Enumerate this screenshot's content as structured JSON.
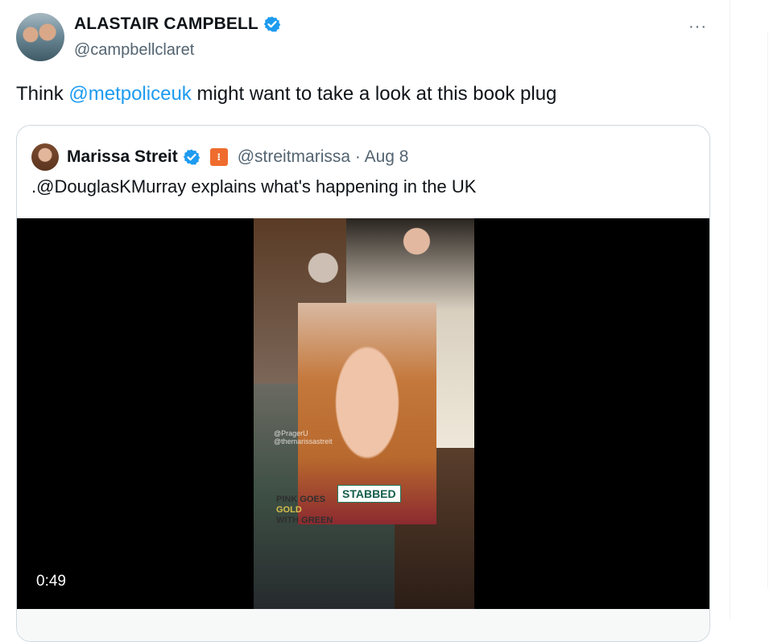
{
  "tweet": {
    "author_name": "ALASTAIR CAMPBELL",
    "author_handle": "@campbellclaret",
    "more_label": "···",
    "text_before": "Think ",
    "mention": "@metpoliceuk",
    "text_after": " might want to take a look at this book plug"
  },
  "quote": {
    "author_name": "Marissa Streit",
    "author_handle": "@streitmarissa",
    "separator": "·",
    "date": "Aug 8",
    "text": ".@DouglasKMurray explains what's happening in the UK",
    "video": {
      "duration": "0:49",
      "watermark_line1": "@PragerU",
      "watermark_line2": "@themarissastreit",
      "overlay_label": "STABBED",
      "shirt_line1": "PINK GOES",
      "shirt_line2": "GOLD",
      "shirt_line3": "WITH GREEN"
    }
  },
  "colors": {
    "link": "#1d9bf0",
    "verified": "#1d9bf0",
    "secondary_text": "#536471",
    "org_badge": "#ef6c2e"
  },
  "icons": {
    "verified": "verified-badge-icon",
    "more": "more-options-icon",
    "org": "organization-badge-icon"
  }
}
